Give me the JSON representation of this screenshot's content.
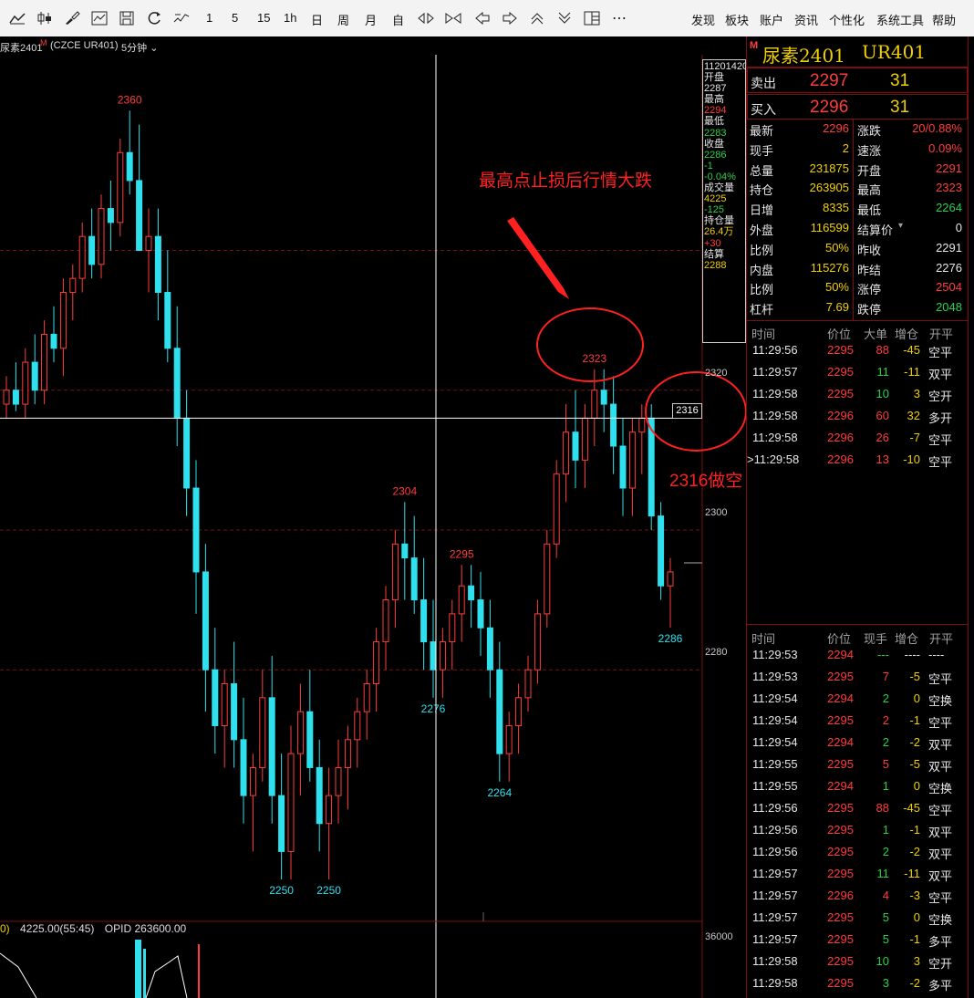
{
  "toolbar": {
    "interval_buttons": [
      "1",
      "5",
      "15",
      "1h",
      "日",
      "周",
      "月",
      "自"
    ],
    "menu": [
      "发现",
      "板块",
      "账户",
      "资讯",
      "个性化",
      "系统工具",
      "帮助"
    ],
    "icons": [
      "trend-line-icon",
      "candle-icon",
      "brush-icon",
      "indicator-icon",
      "save-icon",
      "refresh-icon",
      "signal-icon",
      "diamond-icon",
      "bowtie-icon",
      "arrow-left-icon",
      "arrow-right-icon",
      "arrow-up-icon",
      "arrow-down-icon",
      "layout-icon",
      "more-icon"
    ]
  },
  "infobar": {
    "symbol": "尿素2401",
    "marker": "M",
    "code": "(CZCE UR401)",
    "period": "5分钟",
    "volume_label": "0)",
    "volume_value": "4225.00(55:45)",
    "opid": "OPID 263600.00"
  },
  "colors": {
    "up": "#ff3c3c",
    "down": "#2fe0ee",
    "grid": "#7a1010",
    "crosshair": "#ffffff",
    "annotation": "#ff2020"
  },
  "chart_data": {
    "type": "candlestick",
    "ylim": [
      2244,
      2368
    ],
    "y_ticks": [
      2280,
      2300,
      2320
    ],
    "volume_tick": "36000",
    "crosshair_price": "2316",
    "price_labels": [
      "2360",
      "2304",
      "2295",
      "2323",
      "2276",
      "2264",
      "2250",
      "2250",
      "2286"
    ],
    "candles": [
      [
        2318,
        2322,
        2316,
        2320
      ],
      [
        2320,
        2324,
        2317,
        2318
      ],
      [
        2318,
        2326,
        2316,
        2324
      ],
      [
        2324,
        2328,
        2318,
        2320
      ],
      [
        2320,
        2330,
        2318,
        2328
      ],
      [
        2328,
        2332,
        2324,
        2326
      ],
      [
        2326,
        2336,
        2322,
        2334
      ],
      [
        2334,
        2338,
        2330,
        2336
      ],
      [
        2336,
        2344,
        2334,
        2342
      ],
      [
        2342,
        2346,
        2336,
        2338
      ],
      [
        2338,
        2348,
        2336,
        2346
      ],
      [
        2346,
        2350,
        2340,
        2344
      ],
      [
        2344,
        2356,
        2342,
        2354
      ],
      [
        2354,
        2360,
        2348,
        2350
      ],
      [
        2350,
        2358,
        2346,
        2340
      ],
      [
        2340,
        2346,
        2334,
        2342
      ],
      [
        2342,
        2346,
        2330,
        2334
      ],
      [
        2334,
        2340,
        2324,
        2326
      ],
      [
        2326,
        2332,
        2312,
        2316
      ],
      [
        2316,
        2320,
        2302,
        2306
      ],
      [
        2306,
        2310,
        2288,
        2294
      ],
      [
        2294,
        2298,
        2274,
        2280
      ],
      [
        2280,
        2286,
        2268,
        2272
      ],
      [
        2272,
        2280,
        2266,
        2278
      ],
      [
        2278,
        2284,
        2266,
        2270
      ],
      [
        2270,
        2276,
        2258,
        2262
      ],
      [
        2262,
        2268,
        2254,
        2266
      ],
      [
        2266,
        2280,
        2264,
        2276
      ],
      [
        2276,
        2282,
        2258,
        2262
      ],
      [
        2262,
        2268,
        2250,
        2254
      ],
      [
        2254,
        2272,
        2250,
        2268
      ],
      [
        2268,
        2278,
        2262,
        2274
      ],
      [
        2274,
        2280,
        2264,
        2266
      ],
      [
        2266,
        2270,
        2254,
        2258
      ],
      [
        2258,
        2266,
        2250,
        2262
      ],
      [
        2262,
        2270,
        2258,
        2266
      ],
      [
        2266,
        2272,
        2260,
        2270
      ],
      [
        2270,
        2276,
        2266,
        2274
      ],
      [
        2274,
        2280,
        2270,
        2278
      ],
      [
        2278,
        2286,
        2274,
        2284
      ],
      [
        2284,
        2292,
        2280,
        2290
      ],
      [
        2290,
        2300,
        2286,
        2298
      ],
      [
        2298,
        2304,
        2290,
        2296
      ],
      [
        2296,
        2302,
        2288,
        2290
      ],
      [
        2290,
        2296,
        2280,
        2284
      ],
      [
        2284,
        2290,
        2276,
        2280
      ],
      [
        2280,
        2286,
        2276,
        2284
      ],
      [
        2284,
        2290,
        2280,
        2288
      ],
      [
        2288,
        2295,
        2284,
        2292
      ],
      [
        2292,
        2295,
        2286,
        2290
      ],
      [
        2290,
        2294,
        2282,
        2286
      ],
      [
        2286,
        2290,
        2276,
        2280
      ],
      [
        2280,
        2284,
        2264,
        2268
      ],
      [
        2268,
        2274,
        2264,
        2272
      ],
      [
        2272,
        2278,
        2268,
        2276
      ],
      [
        2276,
        2282,
        2274,
        2280
      ],
      [
        2280,
        2290,
        2278,
        2288
      ],
      [
        2288,
        2300,
        2286,
        2298
      ],
      [
        2298,
        2310,
        2296,
        2308
      ],
      [
        2308,
        2318,
        2304,
        2314
      ],
      [
        2314,
        2320,
        2306,
        2310
      ],
      [
        2310,
        2318,
        2306,
        2316
      ],
      [
        2316,
        2323,
        2312,
        2320
      ],
      [
        2320,
        2323,
        2314,
        2318
      ],
      [
        2318,
        2322,
        2308,
        2312
      ],
      [
        2312,
        2316,
        2302,
        2306
      ],
      [
        2306,
        2316,
        2302,
        2314
      ],
      [
        2314,
        2318,
        2308,
        2316
      ],
      [
        2316,
        2318,
        2300,
        2302
      ],
      [
        2302,
        2304,
        2290,
        2292
      ],
      [
        2292,
        2296,
        2286,
        2294
      ]
    ]
  },
  "annotations": {
    "headline": "最高点止损后行情大跌",
    "short_entry": "2316做空"
  },
  "quote_panel": {
    "marker": "M",
    "name": "尿素2401",
    "code": "UR401",
    "ask_label": "卖出",
    "ask_price": "2297",
    "ask_vol": "31",
    "bid_label": "买入",
    "bid_price": "2296",
    "bid_vol": "31",
    "stats": [
      {
        "l1": "最新",
        "v1": "2296",
        "c1": "rd",
        "l2": "涨跌",
        "v2": "20/0.88%",
        "c2": "rd"
      },
      {
        "l1": "现手",
        "v1": "2",
        "c1": "yl",
        "l2": "速涨",
        "v2": "0.09%",
        "c2": "rd"
      },
      {
        "l1": "总量",
        "v1": "231875",
        "c1": "yl",
        "l2": "开盘",
        "v2": "2291",
        "c2": "rd"
      },
      {
        "l1": "持仓",
        "v1": "263905",
        "c1": "yl",
        "l2": "最高",
        "v2": "2323",
        "c2": "rd"
      },
      {
        "l1": "日增",
        "v1": "8335",
        "c1": "yl",
        "l2": "最低",
        "v2": "2264",
        "c2": "gr"
      },
      {
        "l1": "外盘",
        "v1": "116599",
        "c1": "yl",
        "l2": "结算价",
        "v2": "0",
        "c2": "wh"
      },
      {
        "l1": "比例",
        "v1": "50%",
        "c1": "yl",
        "l2": "昨收",
        "v2": "2291",
        "c2": "wh"
      },
      {
        "l1": "内盘",
        "v1": "115276",
        "c1": "yl",
        "l2": "昨结",
        "v2": "2276",
        "c2": "wh"
      },
      {
        "l1": "比例",
        "v1": "50%",
        "c1": "yl",
        "l2": "涨停",
        "v2": "2504",
        "c2": "rd"
      },
      {
        "l1": "杠杆",
        "v1": "7.69",
        "c1": "yl",
        "l2": "跌停",
        "v2": "2048",
        "c2": "gr"
      }
    ],
    "big_header": [
      "时间",
      "价位",
      "大单",
      "增仓",
      "开平"
    ],
    "big_trades": [
      {
        "t": "11:29:56",
        "p": "2295",
        "v": "88",
        "vc": "rd",
        "d": "-45",
        "dc": "yl",
        "k": "空平"
      },
      {
        "t": "11:29:57",
        "p": "2295",
        "v": "11",
        "vc": "gr",
        "d": "-11",
        "dc": "yl",
        "k": "双平"
      },
      {
        "t": "11:29:58",
        "p": "2295",
        "v": "10",
        "vc": "gr",
        "d": "3",
        "dc": "yl",
        "k": "空开"
      },
      {
        "t": "11:29:58",
        "p": "2296",
        "v": "60",
        "vc": "rd",
        "d": "32",
        "dc": "yl",
        "k": "多开"
      },
      {
        "t": "11:29:58",
        "p": "2296",
        "v": "26",
        "vc": "rd",
        "d": "-7",
        "dc": "yl",
        "k": "空平"
      },
      {
        "t": ">11:29:58",
        "p": "2296",
        "v": "13",
        "vc": "rd",
        "d": "-10",
        "dc": "yl",
        "k": "空平"
      }
    ],
    "tick_header": [
      "时间",
      "价位",
      "现手",
      "增仓",
      "开平"
    ],
    "ticks": [
      {
        "t": "11:29:53",
        "p": "2294",
        "v": "---",
        "vc": "gr",
        "d": "----",
        "dc": "wh",
        "k": "----"
      },
      {
        "t": "11:29:53",
        "p": "2295",
        "v": "7",
        "vc": "rd",
        "d": "-5",
        "dc": "yl",
        "k": "空平"
      },
      {
        "t": "11:29:54",
        "p": "2294",
        "v": "2",
        "vc": "gr",
        "d": "0",
        "dc": "yl",
        "k": "空换"
      },
      {
        "t": "11:29:54",
        "p": "2295",
        "v": "2",
        "vc": "rd",
        "d": "-1",
        "dc": "yl",
        "k": "空平"
      },
      {
        "t": "11:29:54",
        "p": "2294",
        "v": "2",
        "vc": "gr",
        "d": "-2",
        "dc": "yl",
        "k": "双平"
      },
      {
        "t": "11:29:55",
        "p": "2295",
        "v": "5",
        "vc": "rd",
        "d": "-5",
        "dc": "yl",
        "k": "双平"
      },
      {
        "t": "11:29:55",
        "p": "2294",
        "v": "1",
        "vc": "gr",
        "d": "0",
        "dc": "yl",
        "k": "空换"
      },
      {
        "t": "11:29:56",
        "p": "2295",
        "v": "88",
        "vc": "rd",
        "d": "-45",
        "dc": "yl",
        "k": "空平"
      },
      {
        "t": "11:29:56",
        "p": "2295",
        "v": "1",
        "vc": "gr",
        "d": "-1",
        "dc": "yl",
        "k": "双平"
      },
      {
        "t": "11:29:56",
        "p": "2295",
        "v": "2",
        "vc": "gr",
        "d": "-2",
        "dc": "yl",
        "k": "双平"
      },
      {
        "t": "11:29:57",
        "p": "2295",
        "v": "11",
        "vc": "gr",
        "d": "-11",
        "dc": "yl",
        "k": "双平"
      },
      {
        "t": "11:29:57",
        "p": "2296",
        "v": "4",
        "vc": "rd",
        "d": "-3",
        "dc": "yl",
        "k": "空平"
      },
      {
        "t": "11:29:57",
        "p": "2295",
        "v": "5",
        "vc": "gr",
        "d": "0",
        "dc": "yl",
        "k": "空换"
      },
      {
        "t": "11:29:57",
        "p": "2295",
        "v": "5",
        "vc": "gr",
        "d": "-1",
        "dc": "yl",
        "k": "多平"
      },
      {
        "t": "11:29:58",
        "p": "2295",
        "v": "10",
        "vc": "gr",
        "d": "3",
        "dc": "yl",
        "k": "空开"
      },
      {
        "t": "11:29:58",
        "p": "2295",
        "v": "3",
        "vc": "gr",
        "d": "-2",
        "dc": "yl",
        "k": "多平"
      }
    ]
  },
  "data_window": {
    "time": "11201420",
    "items": [
      {
        "label": "开盘",
        "value": "2287",
        "vc": "wh"
      },
      {
        "label": "最高",
        "value": "2294",
        "vc": "rd"
      },
      {
        "label": "最低",
        "value": "2283",
        "vc": "gr"
      },
      {
        "label": "收盘",
        "value": "2286",
        "vc": "gr"
      },
      {
        "label": "",
        "value": "-1",
        "vc": "gr"
      },
      {
        "label": "",
        "value": "-0.04%",
        "vc": "gr"
      },
      {
        "label": "成交量",
        "value": "4225",
        "vc": "yl"
      },
      {
        "label": "",
        "value": "-125",
        "vc": "gr"
      },
      {
        "label": "持仓量",
        "value": "26.4万",
        "vc": "yl"
      },
      {
        "label": "",
        "value": "+30",
        "vc": "rd"
      },
      {
        "label": "结算",
        "value": "2288",
        "vc": "yl"
      }
    ]
  }
}
